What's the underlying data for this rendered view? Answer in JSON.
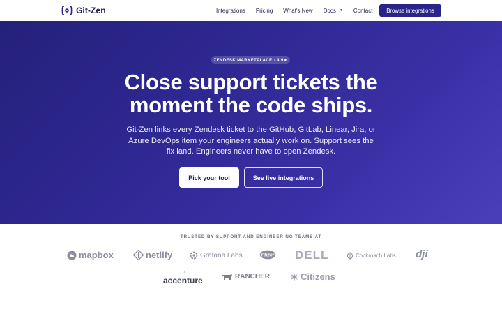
{
  "nav": {
    "brand": "Git-Zen",
    "links": [
      {
        "label": "Integrations"
      },
      {
        "label": "Pricing"
      },
      {
        "label": "What's New"
      },
      {
        "label": "Docs",
        "has_dropdown": true
      },
      {
        "label": "Contact"
      }
    ],
    "cta_label": "Browse integrations",
    "cta_color": "#2a2389",
    "logo_icon": "bracket-gear-icon"
  },
  "hero": {
    "badge": "ZENDESK MARKETPLACE · 4.9★",
    "headline_line1": "Close support tickets the",
    "headline_line2": "moment the code ships.",
    "subtitle": "Git-Zen links every Zendesk ticket to the GitHub, GitLab, Linear, Jira, or Azure DevOps item your engineers actually work on. Support sees the fix land. Engineers never have to open Zendesk.",
    "primary_cta": "Pick your tool",
    "secondary_cta": "See live integrations",
    "gradient_start": "#24217a",
    "gradient_end": "#4a3fb8"
  },
  "trusted": {
    "heading": "TRUSTED BY SUPPORT AND ENGINEERING TEAMS AT",
    "logos": [
      {
        "name": "mapbox",
        "icon": "mapbox-logo"
      },
      {
        "name": "netlify",
        "icon": "netlify-logo"
      },
      {
        "name": "Grafana Labs",
        "icon": "grafana-logo"
      },
      {
        "name": "Pfizer",
        "icon": "pfizer-logo"
      },
      {
        "name": "DELL",
        "icon": "dell-logo"
      },
      {
        "name": "Cockroach Labs",
        "icon": "cockroach-logo"
      },
      {
        "name": "dji",
        "icon": "dji-logo"
      },
      {
        "name": "accenture",
        "icon": "accenture-logo"
      },
      {
        "name": "RANCHER",
        "icon": "rancher-logo"
      },
      {
        "name": "Citizens",
        "icon": "citizens-logo"
      }
    ]
  }
}
